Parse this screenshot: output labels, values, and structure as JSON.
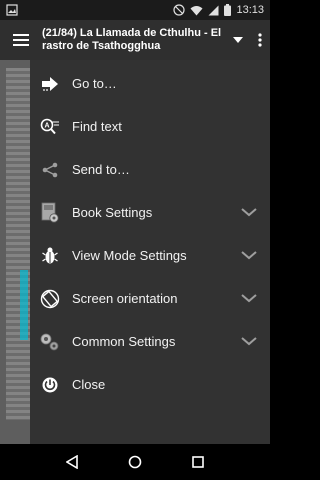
{
  "status_bar": {
    "time": "13:13",
    "icons": [
      "notification-image-icon",
      "dnd-icon",
      "wifi-icon",
      "signal-icon",
      "battery-icon"
    ]
  },
  "app_bar": {
    "title": "(21/84) La Llamada de Cthulhu - El rastro de Tsathogghua",
    "icons": [
      "hamburger-icon",
      "chevron-down-icon",
      "more-vert-icon"
    ]
  },
  "menu": {
    "items": [
      {
        "label": "Go to…",
        "icon": "arrow-right-icon",
        "has_chevron": false
      },
      {
        "label": "Find text",
        "icon": "search-text-icon",
        "has_chevron": false
      },
      {
        "label": "Send to…",
        "icon": "share-icon",
        "has_chevron": false
      },
      {
        "label": "Book Settings",
        "icon": "book-settings-icon",
        "has_chevron": true
      },
      {
        "label": "View Mode Settings",
        "icon": "bug-icon",
        "has_chevron": true
      },
      {
        "label": "Screen orientation",
        "icon": "rotation-icon",
        "has_chevron": true
      },
      {
        "label": "Common Settings",
        "icon": "gears-icon",
        "has_chevron": true
      },
      {
        "label": "Close",
        "icon": "power-icon",
        "has_chevron": false
      }
    ]
  },
  "nav_bar": {
    "icons": [
      "back-icon",
      "home-icon",
      "recents-icon"
    ]
  },
  "colors": {
    "menu_bg": "#323232",
    "appbar_bg": "#2f2f2f",
    "statusbar_bg": "#1b1b1b",
    "icon_gray": "#9e9e9e"
  }
}
